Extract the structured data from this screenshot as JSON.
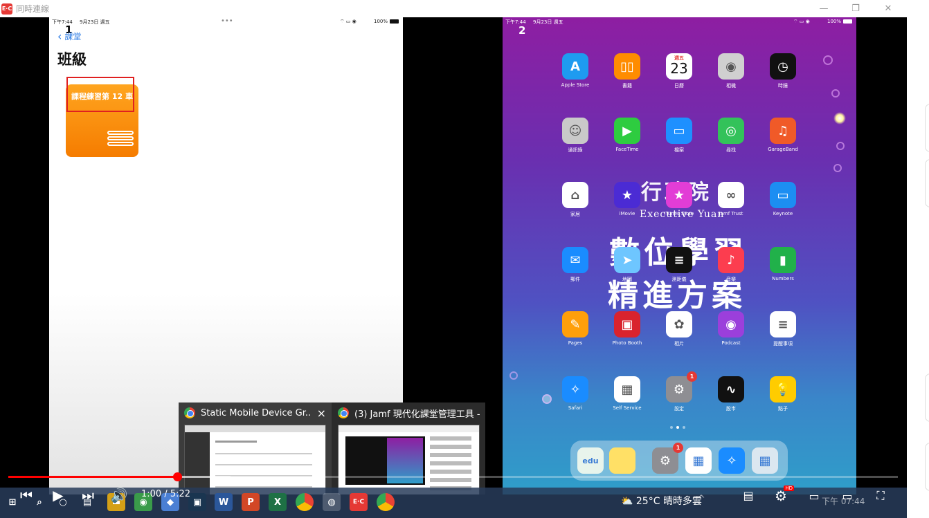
{
  "window": {
    "title": "同時連線",
    "app_logo_text": "E·C"
  },
  "device1": {
    "status_time": "下午7:44",
    "status_date": "9月23日 週五",
    "battery": "100%",
    "ellipsis": "•••",
    "number": "1",
    "back_label": "課堂",
    "title": "班級",
    "class_card_label": "課程練習第 12 車"
  },
  "device2": {
    "status_time": "下午7:44",
    "status_date": "9月23日 週五",
    "battery": "100%",
    "number": "2",
    "wallpaper": {
      "line1": "行政院",
      "line2": "Executive Yuan",
      "line3": "數位學習",
      "line4": "精進方案"
    },
    "calendar": {
      "weekday": "週五",
      "day": "23"
    },
    "apps": [
      {
        "label": "Apple Store",
        "color": "#1e9bf0",
        "glyph": "A",
        "badge": ""
      },
      {
        "label": "書籍",
        "color": "#ff8c00",
        "glyph": "▯▯",
        "badge": ""
      },
      {
        "label": "日曆",
        "color": "#ffffff",
        "glyph": "",
        "badge": ""
      },
      {
        "label": "相機",
        "color": "#d0d0d0",
        "glyph": "◉",
        "badge": ""
      },
      {
        "label": "時鐘",
        "color": "#111111",
        "glyph": "◷",
        "badge": ""
      },
      {
        "label": "通訊錄",
        "color": "#c9c9c9",
        "glyph": "☺",
        "badge": ""
      },
      {
        "label": "FaceTime",
        "color": "#2ecc40",
        "glyph": "▶",
        "badge": ""
      },
      {
        "label": "檔案",
        "color": "#1e90ff",
        "glyph": "▭",
        "badge": ""
      },
      {
        "label": "尋找",
        "color": "#33c25a",
        "glyph": "◎",
        "badge": ""
      },
      {
        "label": "GarageBand",
        "color": "#f05a28",
        "glyph": "♫",
        "badge": ""
      },
      {
        "label": "家居",
        "color": "#ffffff",
        "glyph": "⌂",
        "badge": ""
      },
      {
        "label": "iMovie",
        "color": "#4b2bd4",
        "glyph": "★",
        "badge": ""
      },
      {
        "label": "iTunes Store",
        "color": "#e23dd6",
        "glyph": "★",
        "badge": ""
      },
      {
        "label": "Jamf Trust",
        "color": "#ffffff",
        "glyph": "∞",
        "badge": ""
      },
      {
        "label": "Keynote",
        "color": "#1c8ef2",
        "glyph": "▭",
        "badge": ""
      },
      {
        "label": "郵件",
        "color": "#1a8cff",
        "glyph": "✉",
        "badge": ""
      },
      {
        "label": "地圖",
        "color": "#6ec6ff",
        "glyph": "➤",
        "badge": ""
      },
      {
        "label": "測距儀",
        "color": "#111111",
        "glyph": "≡",
        "badge": ""
      },
      {
        "label": "音樂",
        "color": "#fc3d4f",
        "glyph": "♪",
        "badge": ""
      },
      {
        "label": "Numbers",
        "color": "#21b14a",
        "glyph": "▮",
        "badge": ""
      },
      {
        "label": "Pages",
        "color": "#ff9f0a",
        "glyph": "✎",
        "badge": ""
      },
      {
        "label": "Photo Booth",
        "color": "#d9232d",
        "glyph": "▣",
        "badge": ""
      },
      {
        "label": "相片",
        "color": "#ffffff",
        "glyph": "✿",
        "badge": ""
      },
      {
        "label": "Podcast",
        "color": "#9b3fdb",
        "glyph": "◉",
        "badge": ""
      },
      {
        "label": "提醒事項",
        "color": "#ffffff",
        "glyph": "≡",
        "badge": ""
      },
      {
        "label": "Safari",
        "color": "#1a8cff",
        "glyph": "✧",
        "badge": ""
      },
      {
        "label": "Self Service",
        "color": "#ffffff",
        "glyph": "▦",
        "badge": ""
      },
      {
        "label": "設定",
        "color": "#8e8e93",
        "glyph": "⚙",
        "badge": "1"
      },
      {
        "label": "股市",
        "color": "#111111",
        "glyph": "∿",
        "badge": ""
      },
      {
        "label": "點子",
        "color": "#ffcc00",
        "glyph": "💡",
        "badge": ""
      }
    ],
    "dock": [
      {
        "name": "edu-app",
        "color": "#e8f4ec",
        "glyph": "edu",
        "badge": ""
      },
      {
        "name": "notes-app",
        "color": "#ffe066",
        "glyph": "",
        "badge": ""
      },
      {
        "name": "settings-app",
        "color": "#8e8e93",
        "glyph": "⚙",
        "badge": "1"
      },
      {
        "name": "self-service-app",
        "color": "#ffffff",
        "glyph": "▦",
        "badge": ""
      },
      {
        "name": "safari-app",
        "color": "#1a8cff",
        "glyph": "✧",
        "badge": ""
      },
      {
        "name": "app-folder",
        "color": "#dbe7f0",
        "glyph": "▦",
        "badge": ""
      }
    ]
  },
  "thumbnails": [
    {
      "title": "Static Mobile Device Gr...",
      "close": "×"
    },
    {
      "title": "(3) Jamf 現代化課堂管理工具 - ...",
      "close": ""
    }
  ],
  "player": {
    "time": "1:00 / 5:22",
    "progress": 0.19,
    "buffered_to": 0.25,
    "quality_badge": "HD"
  },
  "taskbar": {
    "weather_temp": "25°C",
    "weather_desc": "晴時多雲",
    "clock": "下午 07:44"
  },
  "colors": {
    "progress": "#ff0000",
    "accent_blue": "#2a7ae4",
    "red_box": "#e02020"
  }
}
